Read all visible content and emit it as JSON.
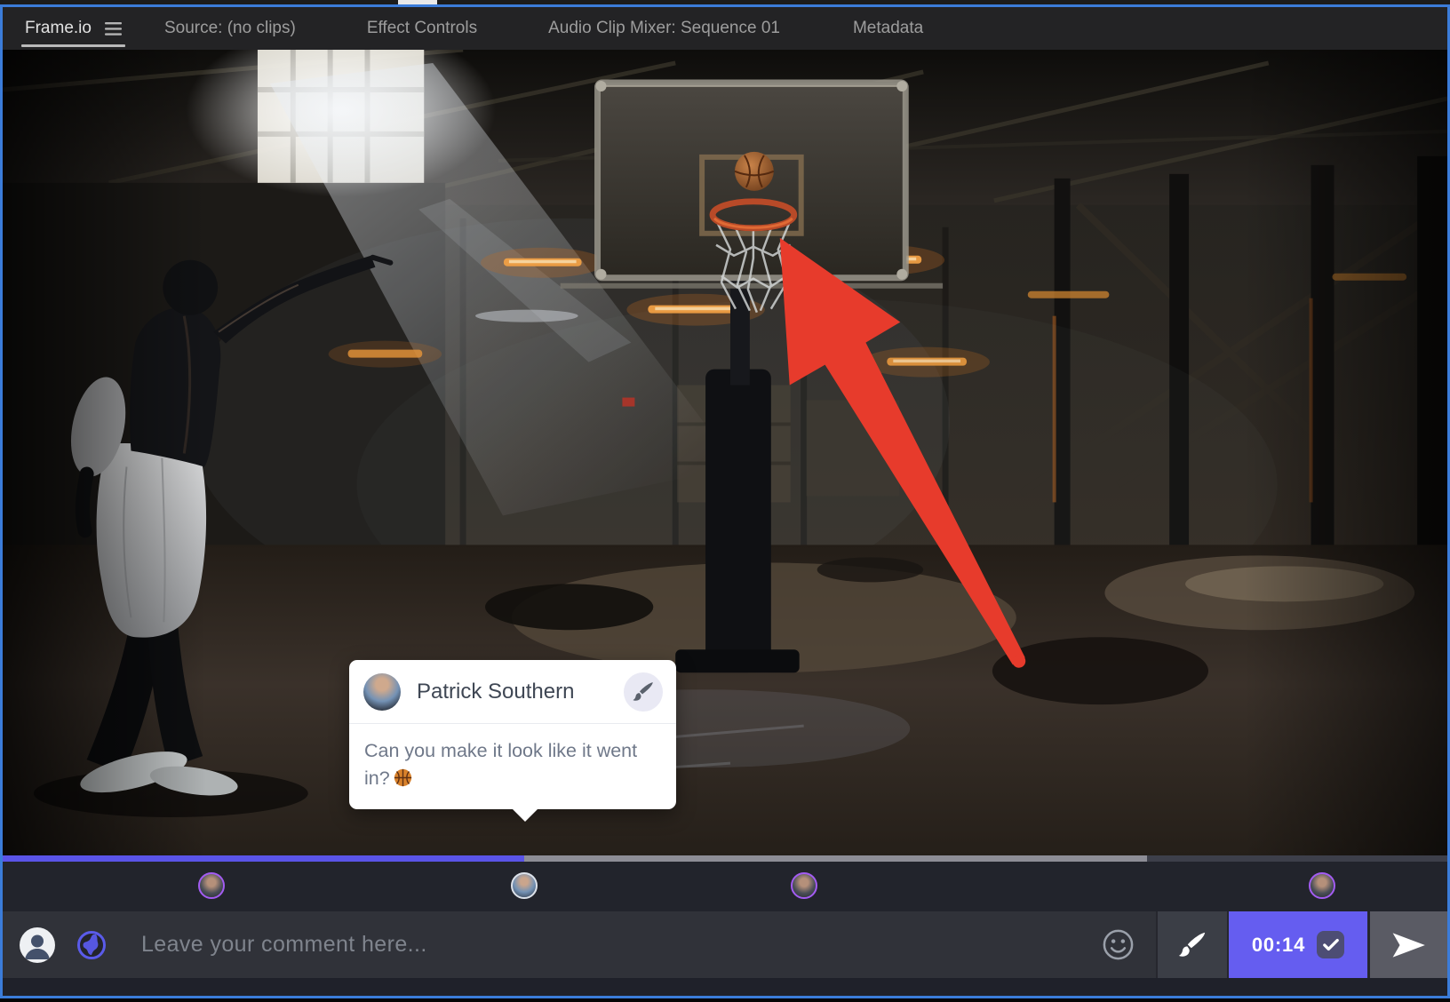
{
  "window": {
    "focus_border_color": "#3b7cd9",
    "app_context": "Frame.io panel inside video editor"
  },
  "tab_bar": {
    "tabs": [
      {
        "label": "Frame.io",
        "active": true
      },
      {
        "label": "Source: (no clips)",
        "active": false
      },
      {
        "label": "Effect Controls",
        "active": false
      },
      {
        "label": "Audio Clip Mixer: Sequence 01",
        "active": false
      },
      {
        "label": "Metadata",
        "active": false
      }
    ]
  },
  "viewer": {
    "scene": "Dark warehouse basketball court: player at left releasing a shot, ball above a rusty rim on a steel backboard, light beam from upper-left window, orange work lights",
    "annotation": {
      "type": "arrow",
      "color": "#e73b2c",
      "points_at": "basketball hoop"
    }
  },
  "comment_popup": {
    "author": "Patrick Southern",
    "text": "Can you make it look like it went in?",
    "emoji": "🏀",
    "tool": "paintbrush"
  },
  "timeline": {
    "played_percent": 36,
    "buffered_percent": 79,
    "played_color": "#5a54e8",
    "markers": [
      {
        "index": 1,
        "ring_color": "#a35cf2"
      },
      {
        "index": 2,
        "ring_color": "#dde2ea",
        "author": "Patrick Southern"
      },
      {
        "index": 3,
        "ring_color": "#a35cf2"
      },
      {
        "index": 4,
        "ring_color": "#a35cf2"
      }
    ]
  },
  "comment_bar": {
    "placeholder": "Leave your comment here...",
    "timestamp_button": {
      "time": "00:14",
      "checked": true,
      "color": "#655df0"
    }
  }
}
